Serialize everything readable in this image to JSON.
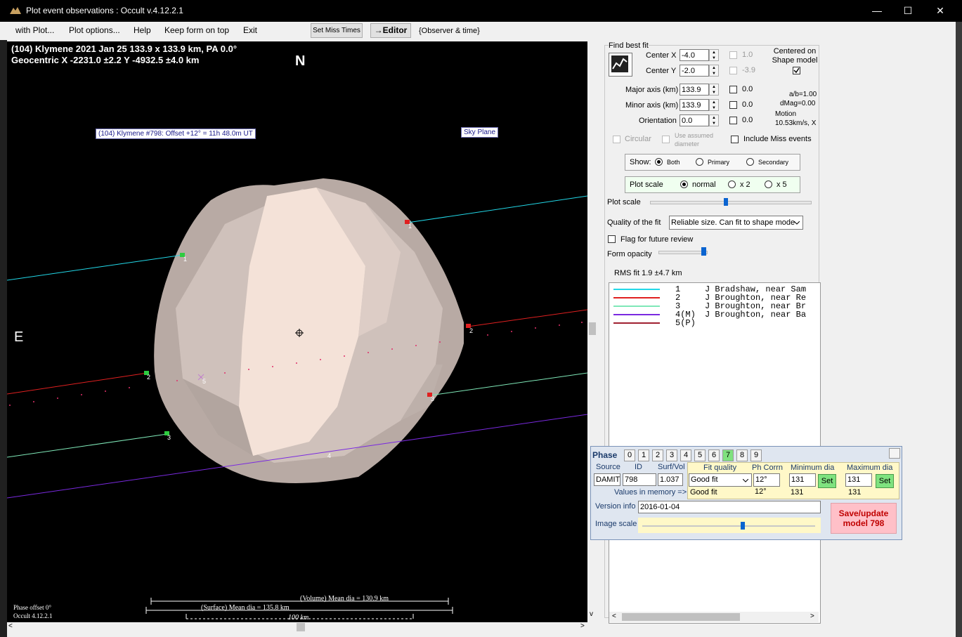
{
  "window": {
    "title": "Plot event observations : Occult v.4.12.2.1",
    "min": "—",
    "max": "☐",
    "close": "✕"
  },
  "menu": {
    "items": [
      "with Plot...",
      "Plot options...",
      "Help",
      "Keep form on top",
      "Exit"
    ],
    "set_miss_times": "Set Miss Times",
    "editor": "→Editor",
    "observer_time": "{Observer & time}"
  },
  "plot": {
    "header1": "(104) Klymene  2021 Jan 25   133.9 x 133.9 km,  PA 0.0°",
    "header2": "Geocentric  X  -2231.0 ±2.2  Y -4932.5 ±4.0 km",
    "north": "N",
    "east": "E",
    "model_label": "(104) Klymene #798: Offset +12° = 11h 48.0m UT",
    "sky_plane": "Sky Plane",
    "chord_labels": [
      "1",
      "2",
      "3",
      "1",
      "2",
      "3",
      "4",
      "5"
    ],
    "volume_dia": "(Volume) Mean dia = 130.9 km",
    "surface_dia": "(Surface) Mean dia = 135.8 km",
    "scale": "100 km",
    "phase_offset": "Phase offset 0°",
    "version": "Occult 4.12.2.1"
  },
  "fit": {
    "title": "Find best fit",
    "center_x_label": "Center X",
    "center_x": "-4.0",
    "center_x_val": "1.0",
    "center_y_label": "Center Y",
    "center_y": "-2.0",
    "center_y_val": "-3.9",
    "centered_label": "Centered on Shape model",
    "major_label": "Major axis (km)",
    "major": "133.9",
    "major_val": "0.0",
    "minor_label": "Minor axis (km)",
    "minor": "133.9",
    "minor_val": "0.0",
    "orient_label": "Orientation",
    "orient": "0.0",
    "orient_val": "0.0",
    "ab": "a/b=1.00",
    "dmag": "dMag=0.00",
    "motion_label": "Motion",
    "motion": "10.53km/s, X",
    "circular": "Circular",
    "use_assumed": "Use assumed diameter",
    "include_miss": "Include Miss events",
    "show_label": "Show:",
    "show_opts": [
      "Both",
      "Primary",
      "Secondary"
    ],
    "plotscale_label": "Plot scale",
    "plotscale_opts": [
      "normal",
      "x 2",
      "x 5"
    ],
    "plotscale_slider_label": "Plot scale",
    "quality_label": "Quality of the fit",
    "quality": "Reliable size. Can fit to shape mode",
    "flag_label": "Flag for future review",
    "opacity_label": "Form opacity",
    "rms": "RMS fit  1.9 ±4.7 km"
  },
  "legend": {
    "rows": [
      {
        "num": "1",
        "text": "J Bradshaw, near Sam",
        "color": "#22d8e8"
      },
      {
        "num": "2",
        "text": "J Broughton, near Re",
        "color": "#e02020"
      },
      {
        "num": "3",
        "text": "J Broughton, near Br",
        "color": "#7fe8b8"
      },
      {
        "num": "4(M)",
        "text": "J Broughton, near Ba",
        "color": "#7a2ae0"
      },
      {
        "num": "5(P)",
        "text": "",
        "color": "#a02030"
      }
    ]
  },
  "phase": {
    "title": "Phase",
    "nums": [
      "0",
      "1",
      "2",
      "3",
      "4",
      "5",
      "6",
      "7",
      "8",
      "9"
    ],
    "source_label": "Source",
    "source": "DAMIT",
    "id_label": "ID",
    "id": "798",
    "surfvol_label": "Surf/Vol",
    "surfvol": "1.037",
    "fitq_label": "Fit quality",
    "fitq": "Good fit",
    "fitq_mem": "Good fit",
    "phcorr_label": "Ph Corrn",
    "phcorr": "12°",
    "phcorr_mem": "12°",
    "mindia_label": "Minimum dia",
    "mindia": "131",
    "mindia_mem": "131",
    "maxdia_label": "Maximum dia",
    "maxdia": "131",
    "maxdia_mem": "131",
    "set": "Set",
    "mem_label": "Values in memory =>",
    "version_label": "Version info",
    "version": "2016-01-04",
    "imgscale_label": "Image scale",
    "save": "Save/update model 798"
  }
}
